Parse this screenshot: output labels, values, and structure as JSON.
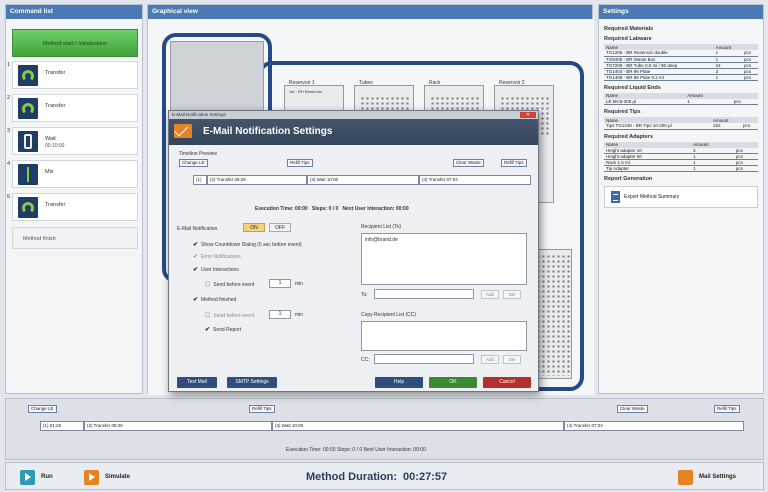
{
  "panels": {
    "command_list": "Command list",
    "graphical_view": "Graphical view",
    "settings": "Settings"
  },
  "commands": {
    "start": "Method start / Initialization",
    "steps": [
      {
        "num": "1",
        "label": "Transfer",
        "sub": "",
        "icon": "transfer-icon"
      },
      {
        "num": "2",
        "label": "Transfer",
        "sub": "",
        "icon": "transfer-icon"
      },
      {
        "num": "3",
        "label": "Wait",
        "sub": "00:10:00",
        "icon": "wait-icon"
      },
      {
        "num": "4",
        "label": "Mix",
        "sub": "",
        "icon": "mix-icon"
      },
      {
        "num": "5",
        "label": "Transfer",
        "sub": "",
        "icon": "transfer-icon"
      }
    ],
    "end": "Method finish"
  },
  "graphical": {
    "slot_labels": [
      "Reservoir 1",
      "Tubes",
      "Rack",
      "Reservoir 2"
    ],
    "plate_labels": [
      "1st - RH Reservoir",
      "",
      "",
      ""
    ]
  },
  "settings": {
    "required_materials": "Required Materials",
    "labware": {
      "title": "Required Labware",
      "cols": [
        "Name",
        "Amount"
      ],
      "rows": [
        [
          "TG1206 - BR Reservoir double",
          "1",
          "pcs"
        ],
        [
          "TG8408 - BR Waste Box",
          "1",
          "pcs"
        ],
        [
          "TG7208 - BR Tube 0.5 ml / 96 deep",
          "24",
          "pcs"
        ],
        [
          "TG1404 - BR 96 Plate",
          "2",
          "pcs"
        ],
        [
          "TG1408 - BR 96 Plate 0.2 ml",
          "1",
          "pcs"
        ]
      ]
    },
    "liquids": {
      "title": "Required Liquid Ends",
      "cols": [
        "Name",
        "Amount"
      ],
      "rows": [
        [
          "LE MC8-300 µl",
          "1",
          "pcs"
        ]
      ]
    },
    "tips": {
      "title": "Required Tips",
      "cols": [
        "Name",
        "Amount"
      ],
      "rows": [
        [
          "Tips TG1248 - BR Tips 10-200 µl",
          "192",
          "pcs"
        ]
      ]
    },
    "adapters": {
      "title": "Required Adapters",
      "cols": [
        "Name",
        "Amount"
      ],
      "rows": [
        [
          "Height adapter 10",
          "2",
          "pcs"
        ],
        [
          "Height adapter 60",
          "1",
          "pcs"
        ],
        [
          "Rack 1.5 ml",
          "1",
          "pcs"
        ],
        [
          "Tip Adapter",
          "1",
          "pcs"
        ]
      ]
    },
    "report": {
      "title": "Report Generation",
      "export": "Export Method Summary"
    }
  },
  "dialog": {
    "window_title": "E-Mail Notification Settings",
    "title": "E-Mail Notification Settings",
    "timeline_preview": "Timeline Preview",
    "change_lc": "Change LE",
    "refill_tips": "Refill Tips",
    "clear_waste": "Clear Waste",
    "refill_tips2": "Refill Tips",
    "segments": [
      "(1)",
      "(2) Transfer 08:26",
      "(3) Wait 10:00",
      "(4) Transfer 07:04"
    ],
    "execution_time_label": "Execution Time:",
    "execution_time": "00:00",
    "steps_label": "Steps:",
    "steps": "0 / 0",
    "next_label": "Next User Interaction:",
    "next_value": "00:00",
    "email_notification": "E-Mail Notification",
    "on": "ON",
    "off": "OFF",
    "checks": {
      "countdown": "Show Countdown Dialog (5 sec before event)",
      "error": "Error Notifications",
      "user_interactions": "User Interactions",
      "send_before": "Send before event",
      "minutes1": "1",
      "min": "min",
      "method_finished": "Method finished",
      "send_before2": "Send before event",
      "minutes2": "1",
      "min2": "min",
      "send_report": "Send Report"
    },
    "recipient_label": "Recipient List (To)",
    "recipient_value": "info@brand.de",
    "to_label": "To:",
    "copy_label": "Copy Recipient List (CC)",
    "cc_label": "CC:",
    "add": "Add",
    "del": "Del",
    "buttons": {
      "test_mail": "Test Mail",
      "smtp": "SMTP Settings",
      "help": "Help",
      "ok": "OK",
      "cancel": "Cancel"
    }
  },
  "timeline": {
    "change_lc": "Change LE",
    "refill_tips": "Refill Tips",
    "clear_waste": "Clear Waste",
    "refill_tips2": "Refill Tips",
    "segments": [
      "(1) 01:28",
      "(2) Transfer 08:26",
      "(3) Wait 10:00",
      "(4) Transfer 07:04"
    ],
    "summary": "Execution Time: 00:00   Steps: 0 / 0   Next User Interaction: 00:00"
  },
  "bottom": {
    "run": "Run",
    "simulate": "Simulate",
    "duration_label": "Method Duration:",
    "duration": "00:27:57",
    "mail": "Mail Settings"
  },
  "colors": {
    "accent": "#4b79b3",
    "green": "#4ab045",
    "orange": "#e58424",
    "red": "#b3302b"
  }
}
